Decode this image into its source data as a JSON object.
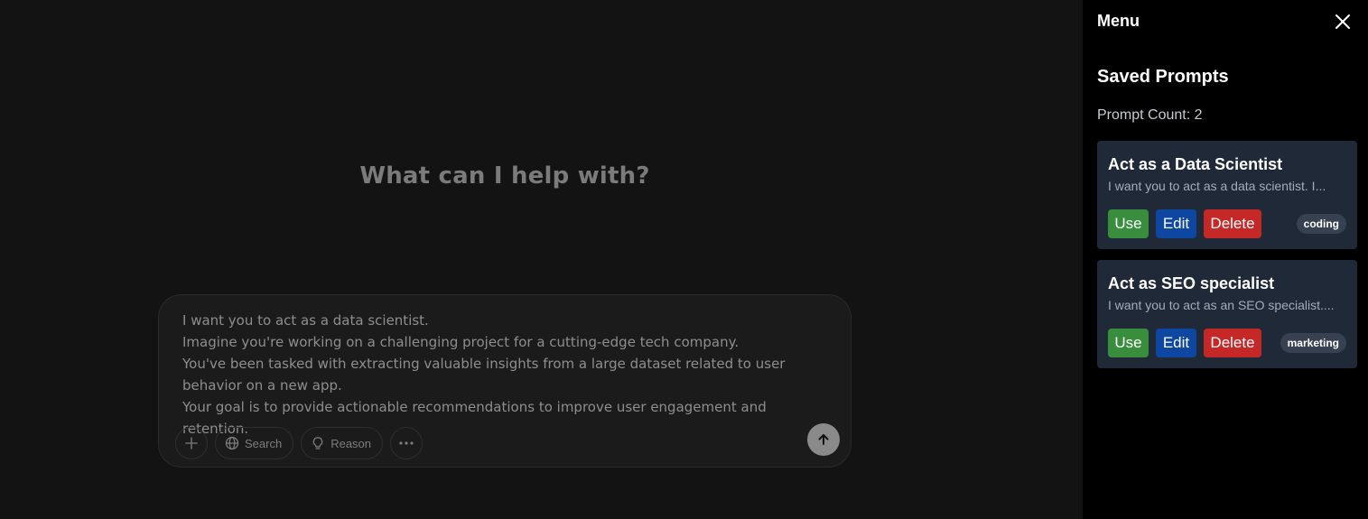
{
  "main": {
    "headline": "What can I help with?",
    "prompt_text": "I want you to act as a data scientist.\nImagine you're working on a challenging project for a cutting-edge tech company.\nYou've been tasked with extracting valuable insights from a large dataset related to user behavior on a new app.\nYour goal is to provide actionable recommendations to improve user engagement and retention.",
    "tools": {
      "search_label": "Search",
      "reason_label": "Reason"
    }
  },
  "sidebar": {
    "title": "Menu",
    "section_title": "Saved Prompts",
    "count_line": "Prompt Count: 2",
    "prompts": [
      {
        "title": "Act as a Data Scientist",
        "description": "I want you to act as a data scientist. I...",
        "tag": "coding",
        "use_label": "Use",
        "edit_label": "Edit",
        "delete_label": "Delete"
      },
      {
        "title": "Act as SEO specialist",
        "description": "I want you to act as an SEO specialist....",
        "tag": "marketing",
        "use_label": "Use",
        "edit_label": "Edit",
        "delete_label": "Delete"
      }
    ]
  },
  "colors": {
    "use": "#388e3c",
    "edit": "#0d47a1",
    "delete": "#c62828",
    "card_bg": "#1f2937"
  },
  "icons": {
    "close": "close-icon",
    "add": "plus-icon",
    "search": "globe-icon",
    "reason": "lightbulb-icon",
    "more": "more-horizontal-icon",
    "send": "arrow-up-icon"
  }
}
